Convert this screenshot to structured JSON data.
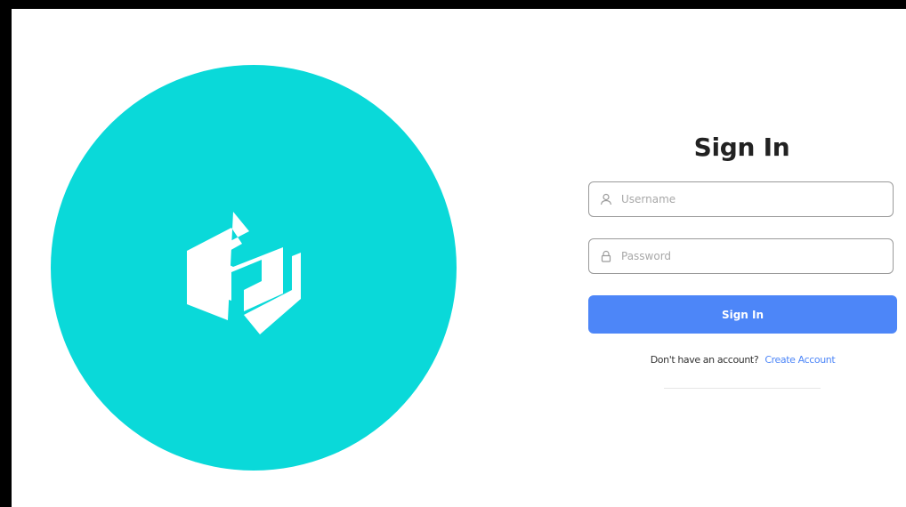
{
  "colors": {
    "logo_circle": "#0ad9d9",
    "primary_button": "#4d86f8",
    "link": "#4d86f8"
  },
  "brand": {
    "logo_icon": "hexagon-s-logo-icon"
  },
  "signin": {
    "title": "Sign In",
    "username_placeholder": "Username",
    "password_placeholder": "Password",
    "button_label": "Sign In",
    "no_account_text": "Don't have an account?",
    "create_account_link": "Create Account"
  }
}
